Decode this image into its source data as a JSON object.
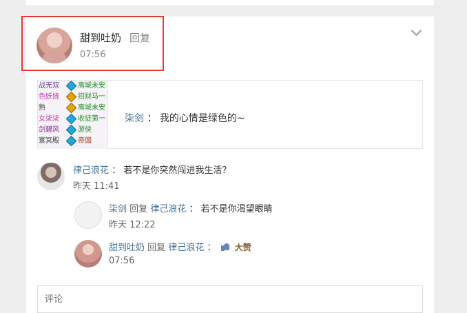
{
  "post": {
    "author": "甜到吐奶",
    "reply_action": "回复",
    "time": "07:56"
  },
  "quote": {
    "author": "柒剑",
    "separator": "：",
    "content": "我的心情是绿色的~",
    "image_rows": [
      {
        "left": "战无双",
        "right": "离城未安"
      },
      {
        "left": "色妖娆",
        "right": "招财马一"
      },
      {
        "left": "熟",
        "right": "离城未安"
      },
      {
        "left": "女柒柒",
        "right": "收徒第一"
      },
      {
        "left": "剑碧风",
        "right": "游侠"
      },
      {
        "left": "寰冥殿",
        "right": "帝国"
      }
    ]
  },
  "comments": [
    {
      "author": "律己浪花",
      "separator": "：",
      "content": "若不是你突然闯进我生活？",
      "time": "昨天 11:41"
    },
    {
      "author": "柒剑",
      "reply_word": "回复",
      "target": "律己浪花",
      "separator": "：",
      "content": "若不是你渴望眼睛",
      "time": "昨天 12:22"
    },
    {
      "author": "甜到吐奶",
      "reply_word": "回复",
      "target": "律己浪花",
      "separator": "：",
      "content": "大赞",
      "time": "07:56"
    }
  ],
  "comment_input": {
    "placeholder": "评论"
  }
}
